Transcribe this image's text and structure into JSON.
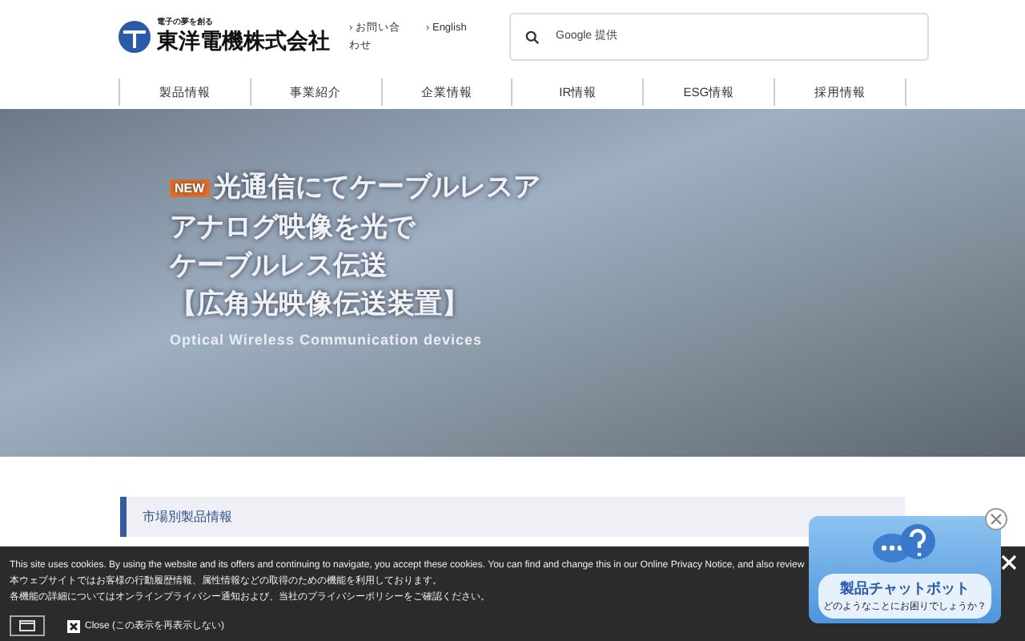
{
  "header": {
    "tagline": "電子の夢を創る",
    "company": "東洋電機株式会社",
    "links": [
      {
        "chevron": "›",
        "label": "お問い合わせ"
      },
      {
        "chevron": "›",
        "label": "English"
      }
    ],
    "search": {
      "placeholder": "Google 提供"
    }
  },
  "nav": [
    "製品情報",
    "事業紹介",
    "企業情報",
    "IR情報",
    "ESG情報",
    "採用情報"
  ],
  "hero": {
    "badge": "NEW",
    "lines": [
      "光通信にてケーブルレスア",
      "アナログ映像を光で",
      "ケーブルレス伝送",
      "【広角光映像伝送装置】"
    ],
    "subtitle": "Optical Wireless Communication devices"
  },
  "section": {
    "title": "市場別製品情報"
  },
  "cookie": {
    "lines": [
      "This site uses cookies. By using the website and its offers and continuing to navigate, you accept these cookies. You can find and change this in our Online Privacy Notice, and also review",
      "本ウェブサイトではお客様の行動履歴情報、属性情報などの取得のための機能を利用しております。",
      "各機能の詳細についてはオンラインプライバシー通知および、当社のプライバシーポリシーをご確認ください。"
    ],
    "close_label": "Close (この表示を再表示しない)"
  },
  "chat": {
    "title": "製品チャットボット",
    "subtitle": "どのようなことにお困りでしょうか？"
  }
}
